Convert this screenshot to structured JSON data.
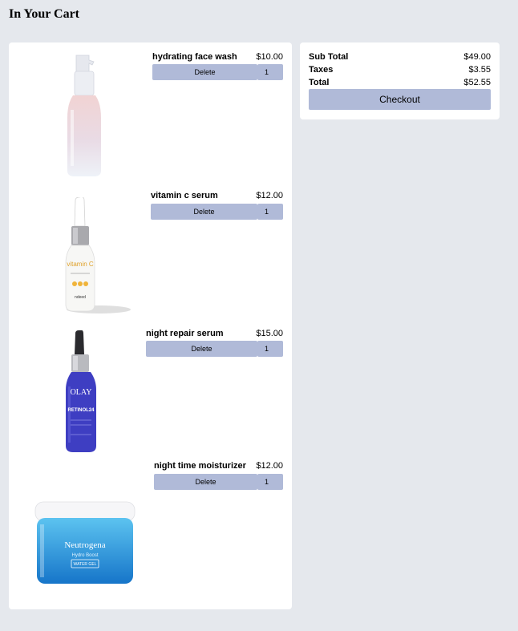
{
  "page": {
    "title": "In Your Cart"
  },
  "cart": {
    "delete_label": "Delete",
    "items": [
      {
        "name": "hydrating face wash",
        "price": "$10.00",
        "quantity": "1",
        "image_icon": "cleanser-bottle-icon"
      },
      {
        "name": "vitamin c serum",
        "price": "$12.00",
        "quantity": "1",
        "image_icon": "vitamin-c-dropper-bottle-icon"
      },
      {
        "name": "night repair serum",
        "price": "$15.00",
        "quantity": "1",
        "image_icon": "retinol-dropper-bottle-icon"
      },
      {
        "name": "night time moisturizer",
        "price": "$12.00",
        "quantity": "1",
        "image_icon": "moisturizer-jar-icon"
      }
    ],
    "product_label_text": {
      "vitamin_c": "vitamin C",
      "vitamin_c_brand": "ndeed",
      "olay_brand": "OLAY",
      "olay_product": "RETINOL24",
      "neutrogena_brand": "Neutrogena",
      "neutrogena_product": "Hydro Boost",
      "neutrogena_sub": "WATER GEL"
    }
  },
  "summary": {
    "subtotal_label": "Sub Total",
    "subtotal_value": "$49.00",
    "taxes_label": "Taxes",
    "taxes_value": "$3.55",
    "total_label": "Total",
    "total_value": "$52.55",
    "checkout_label": "Checkout"
  },
  "colors": {
    "background": "#e5e8ed",
    "panel": "#ffffff",
    "button": "#b0bad8",
    "olay_purple": "#3d3dbf",
    "neutrogena_blue": "#1e9ae0"
  }
}
